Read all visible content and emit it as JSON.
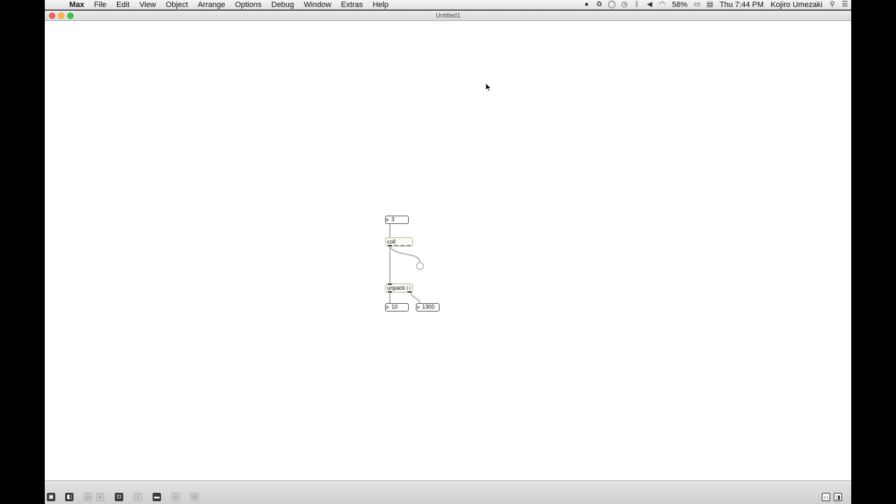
{
  "menubar": {
    "apple_icon": "apple-icon",
    "items": [
      "Max",
      "File",
      "Edit",
      "View",
      "Object",
      "Arrange",
      "Options",
      "Debug",
      "Window",
      "Extras",
      "Help"
    ],
    "status": {
      "battery": "58%",
      "clock": "Thu 7:44 PM",
      "user": "Kojiro Umezaki"
    }
  },
  "window": {
    "title": "Untitled1"
  },
  "patch": {
    "number_in": "3",
    "coll_label": "coll",
    "unpack_label": "unpack i i",
    "number_out_left": "10",
    "number_out_right": "1300"
  },
  "colors": {
    "patch_cord": "#b8b8b8",
    "box_border": "#5a5a5a",
    "object_border": "#bcb79a",
    "canvas": "#ffffff"
  }
}
